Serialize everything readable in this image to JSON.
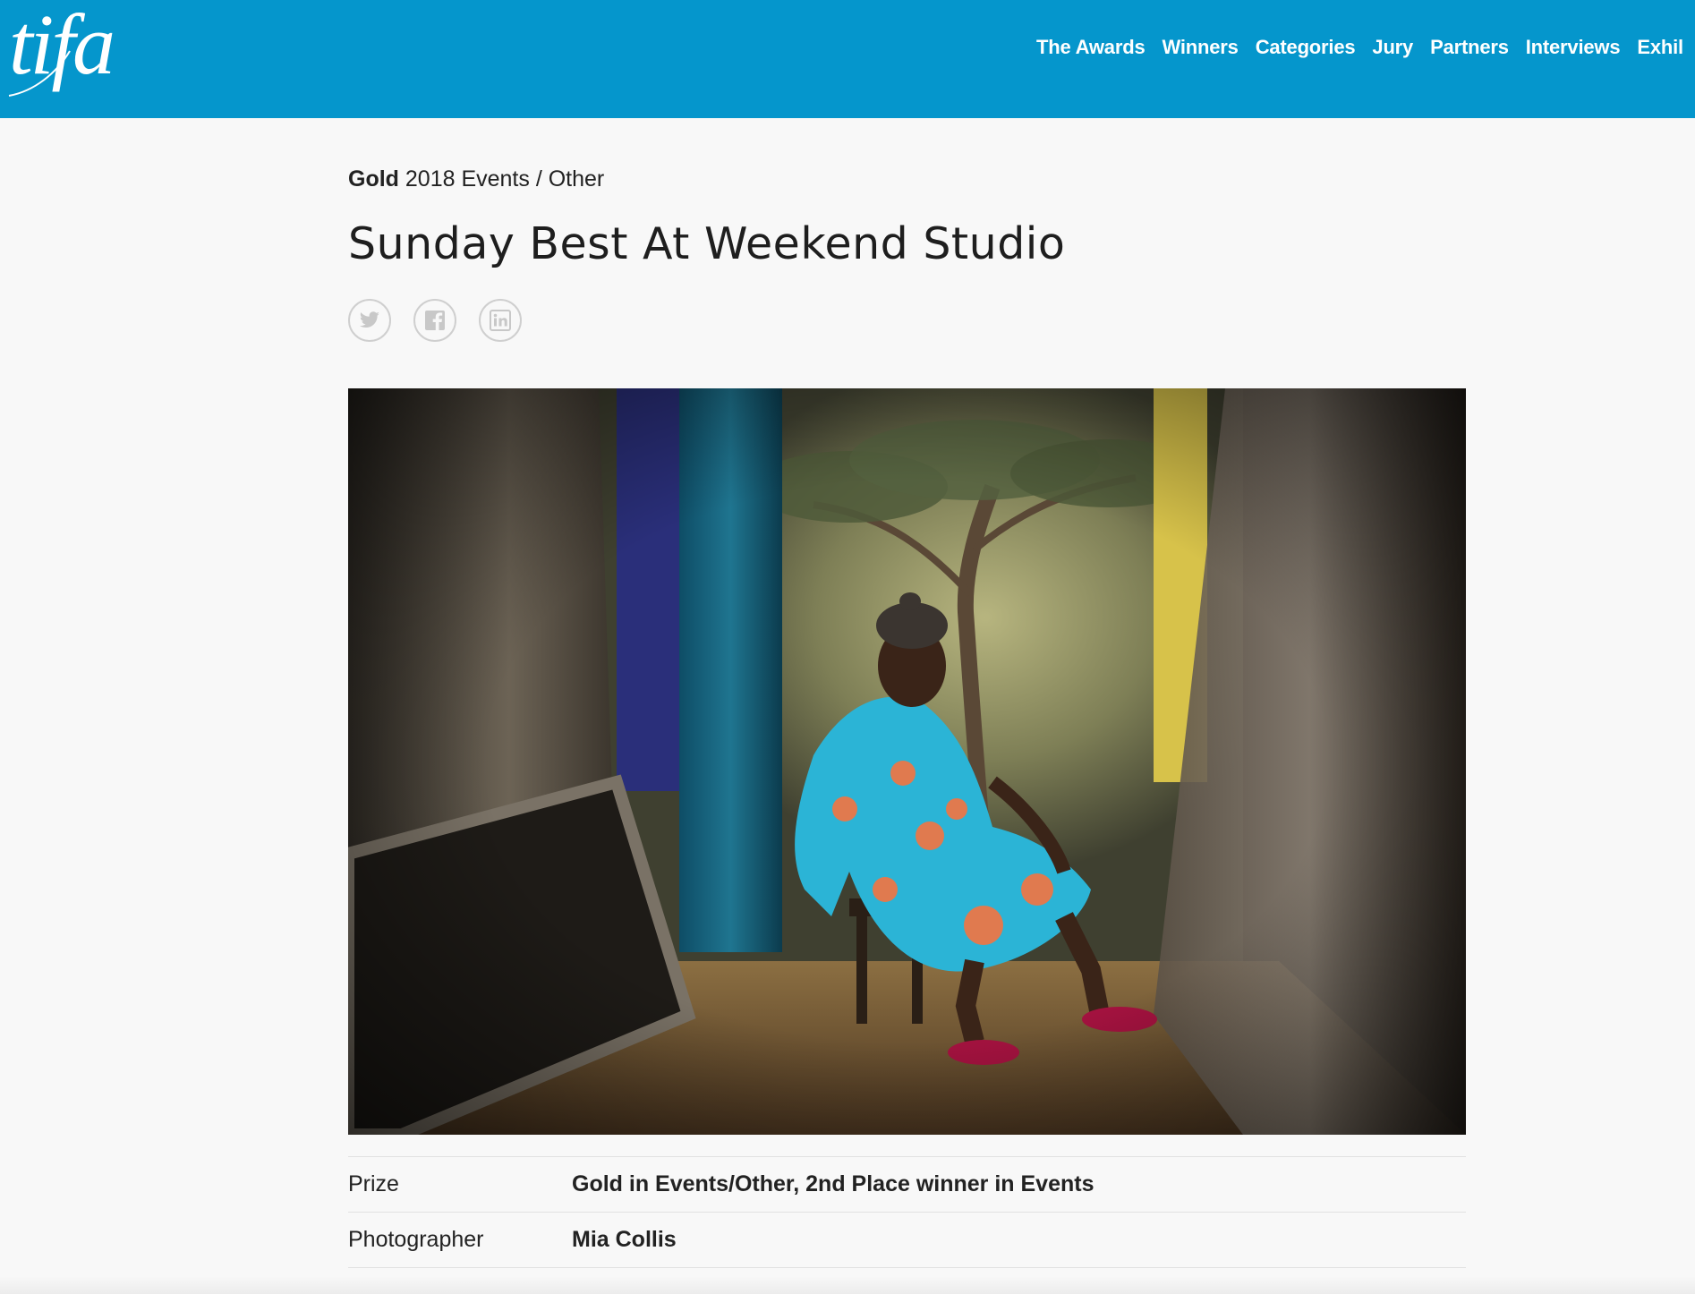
{
  "site": {
    "logo_text": "tifa"
  },
  "nav": {
    "items": [
      "The Awards",
      "Winners",
      "Categories",
      "Jury",
      "Partners",
      "Interviews",
      "Exhil"
    ]
  },
  "entry": {
    "level": "Gold",
    "category_path": "2018 Events / Other",
    "title": "Sunday Best At Weekend Studio",
    "share": [
      {
        "name": "twitter-icon"
      },
      {
        "name": "facebook-icon"
      },
      {
        "name": "linkedin-icon"
      }
    ],
    "details": [
      {
        "label": "Prize",
        "value": "Gold in Events/Other, 2nd Place winner in Events"
      },
      {
        "label": "Photographer",
        "value": "Mia Collis"
      }
    ]
  },
  "colors": {
    "header_bg": "#0596cc",
    "page_bg": "#f8f8f8",
    "share_icon": "#c8c8c8"
  }
}
